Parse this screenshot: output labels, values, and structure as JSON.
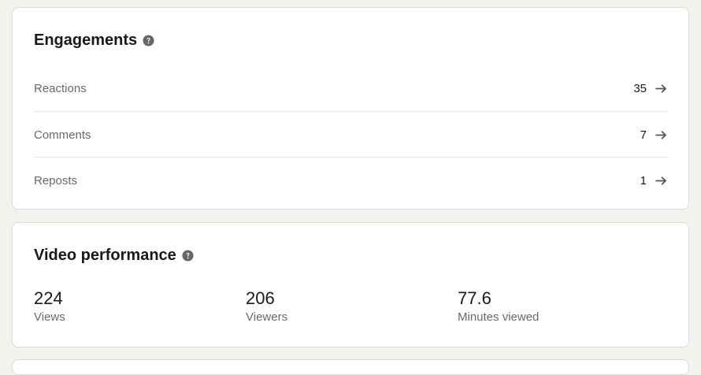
{
  "engagements": {
    "title": "Engagements",
    "rows": [
      {
        "label": "Reactions",
        "count": "35"
      },
      {
        "label": "Comments",
        "count": "7"
      },
      {
        "label": "Reposts",
        "count": "1"
      }
    ],
    "icons": {
      "help": "help-icon",
      "arrow": "arrow-right-icon"
    }
  },
  "video_performance": {
    "title": "Video performance",
    "metrics": [
      {
        "value": "224",
        "label": "Views"
      },
      {
        "value": "206",
        "label": "Viewers"
      },
      {
        "value": "77.6",
        "label": "Minutes viewed"
      }
    ]
  },
  "colors": {
    "page_background": "#f3f2ef",
    "card_background": "#ffffff",
    "icon": "#666666"
  }
}
